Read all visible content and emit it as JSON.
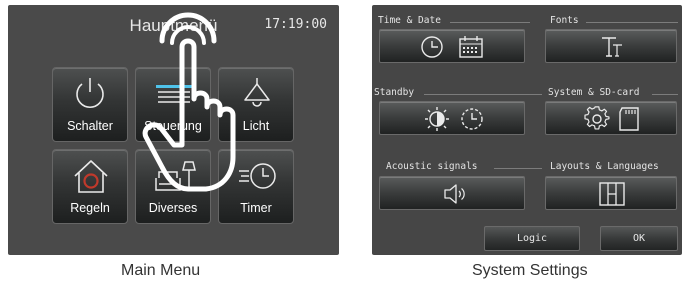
{
  "main_menu": {
    "title": "Hauptmenü",
    "clock": "17:19:00",
    "tiles": [
      {
        "label": "Schalter",
        "icon": "power-icon"
      },
      {
        "label": "Steuerung",
        "icon": "control-lines-icon"
      },
      {
        "label": "Licht",
        "icon": "lamp-icon"
      },
      {
        "label": "Regeln",
        "icon": "house-icon"
      },
      {
        "label": "Diverses",
        "icon": "sofa-lamp-icon"
      },
      {
        "label": "Timer",
        "icon": "timer-clock-icon"
      }
    ],
    "caption": "Main Menu"
  },
  "system_settings": {
    "groups": {
      "time_date": "Time & Date",
      "fonts": "Fonts",
      "standby": "Standby",
      "system_sd": "System & SD-card",
      "acoustic": "Acoustic signals",
      "layouts": "Layouts & Languages"
    },
    "logic_label": "Logic",
    "ok_label": "OK",
    "caption": "System Settings"
  },
  "colors": {
    "screen_bg": "#4a4a4a",
    "text": "#e8e8e8",
    "accent_blue": "#4fc3ea",
    "house_red": "#c0392b"
  }
}
